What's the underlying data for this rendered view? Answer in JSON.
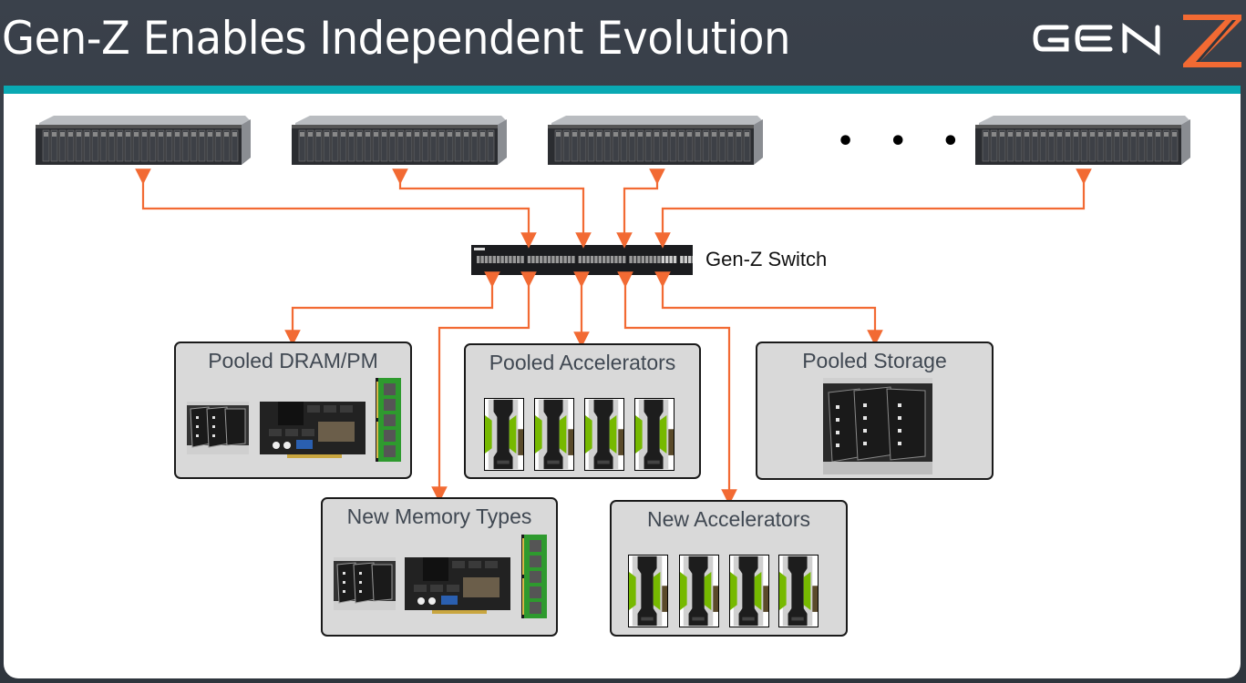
{
  "slide": {
    "title": "Gen-Z Enables Independent Evolution",
    "logo": {
      "text_left": "GEN",
      "text_right": "Z",
      "icon": "genz-logo-icon"
    }
  },
  "colors": {
    "header_bg": "#343a42",
    "accent_bar": "#09a9b3",
    "connector": "#f26a33",
    "box_fill": "#d9d9d9",
    "gpu_green": "#76b900",
    "dimm_green": "#2e9a2e",
    "logo_z": "#f26a33"
  },
  "servers": [
    {
      "name": "server-1",
      "icon": "rack-server-icon"
    },
    {
      "name": "server-2",
      "icon": "rack-server-icon"
    },
    {
      "name": "server-3",
      "icon": "rack-server-icon"
    },
    {
      "name": "server-n",
      "icon": "rack-server-icon"
    }
  ],
  "ellipsis": "• • •",
  "switch": {
    "label": "Gen-Z Switch",
    "icon": "network-switch-icon"
  },
  "pools": [
    {
      "title": "Pooled DRAM/PM",
      "images": [
        "storage-sled-icon",
        "pcie-memory-card-icon",
        "dimm-module-icon"
      ]
    },
    {
      "title": "Pooled Accelerators",
      "images": [
        "gpu-card-icon",
        "gpu-card-icon",
        "gpu-card-icon",
        "gpu-card-icon"
      ]
    },
    {
      "title": "Pooled Storage",
      "images": [
        "drive-bay-icon"
      ]
    },
    {
      "title": "New Memory Types",
      "images": [
        "storage-sled-icon",
        "pcie-memory-card-icon",
        "dimm-module-icon"
      ]
    },
    {
      "title": "New Accelerators",
      "images": [
        "gpu-card-icon",
        "gpu-card-icon",
        "gpu-card-icon",
        "gpu-card-icon"
      ]
    }
  ]
}
